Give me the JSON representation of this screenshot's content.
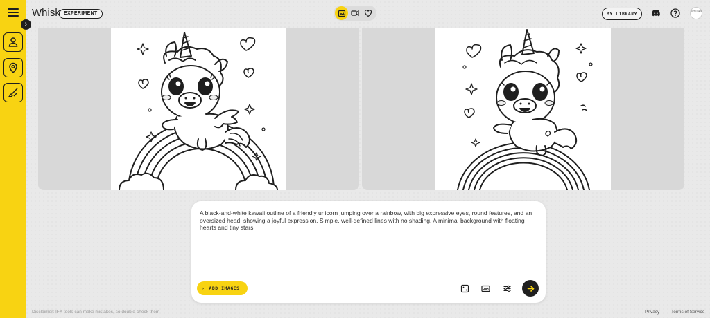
{
  "app": {
    "title": "Whisk",
    "badge": "EXPERIMENT"
  },
  "sidebar": {
    "tools": [
      {
        "icon": "person-icon"
      },
      {
        "icon": "location-pin-icon"
      },
      {
        "icon": "brush-icon"
      }
    ]
  },
  "header": {
    "modes": [
      {
        "icon": "image-gen-icon",
        "active": true
      },
      {
        "icon": "video-icon",
        "active": false
      },
      {
        "icon": "heart-icon",
        "active": false
      }
    ],
    "library_label": "MY LIBRARY",
    "right_icons": [
      "discord-icon",
      "help-icon"
    ],
    "avatar_text": "AUTO GEN"
  },
  "prompt": {
    "text": "A black-and-white kawaii outline of a friendly unicorn jumping over a rainbow, with big expressive eyes, round features, and an oversized head, showing a joyful expression. Simple, well-defined lines with no shading. A minimal background with floating hearts and tiny stars.",
    "add_images_label": "ADD IMAGES"
  },
  "footer": {
    "disclaimer": "Disclaimer: IFX tools can make mistakes, so double-check them",
    "privacy": "Privacy",
    "terms": "Terms of Service"
  },
  "colors": {
    "accent": "#f8d312",
    "dark": "#1f1f1f"
  }
}
